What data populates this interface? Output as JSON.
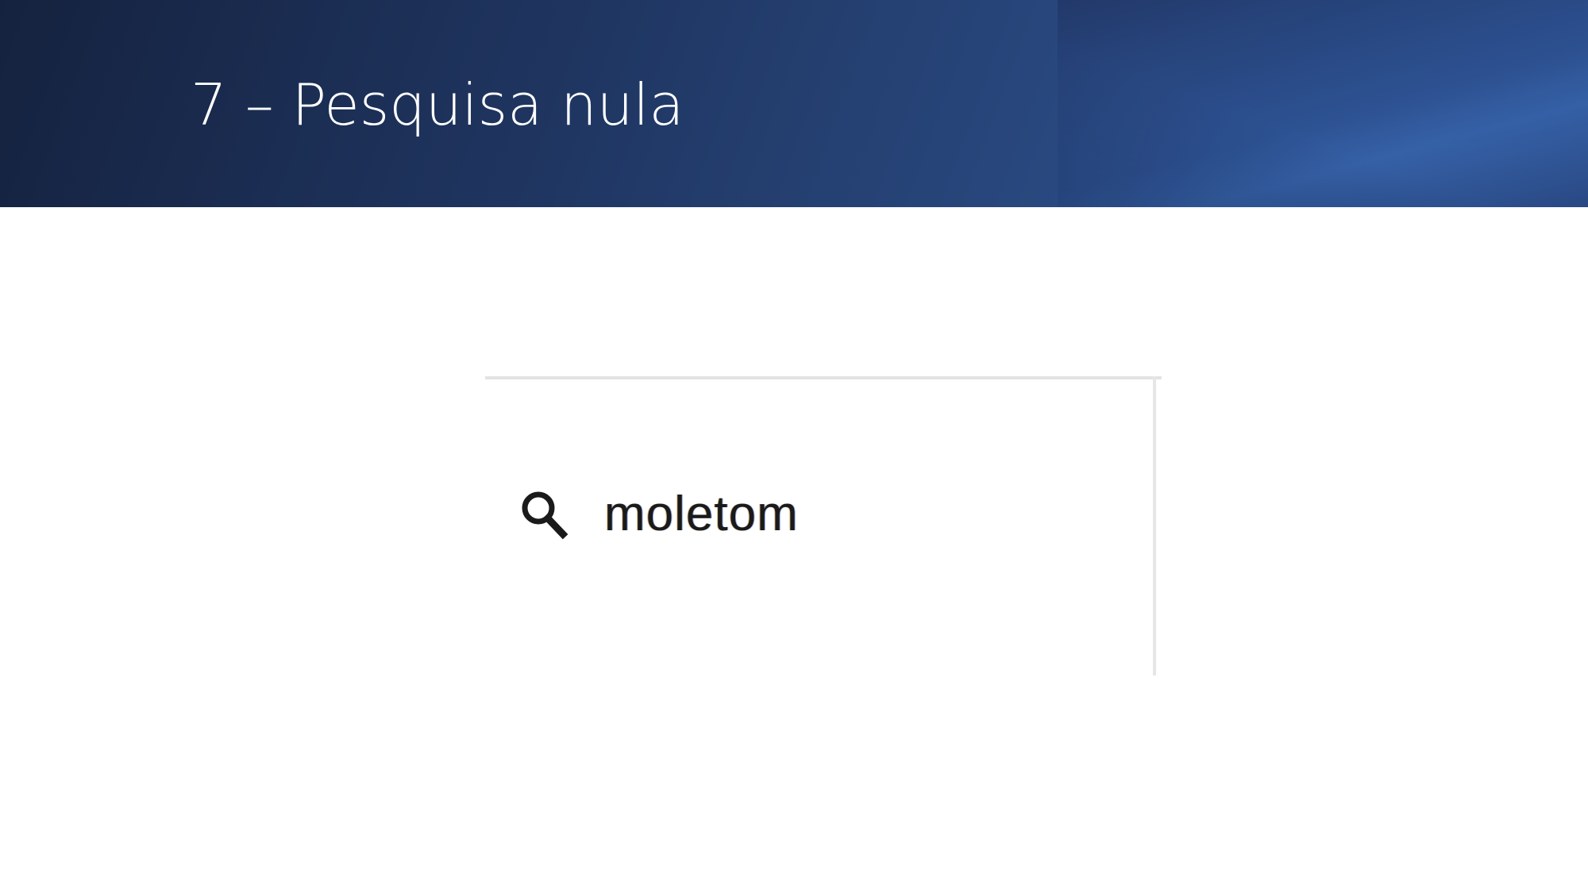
{
  "slide": {
    "title": "7 – Pesquisa nula"
  },
  "search": {
    "icon": "search-icon",
    "value": "moletom"
  },
  "colors": {
    "header_dark": "#15223f",
    "header_mid": "#2a4a82",
    "header_accent": "#3763aa",
    "title_text": "#ffffff",
    "search_text": "#1a1a1a",
    "border": "#e3e3e3"
  }
}
